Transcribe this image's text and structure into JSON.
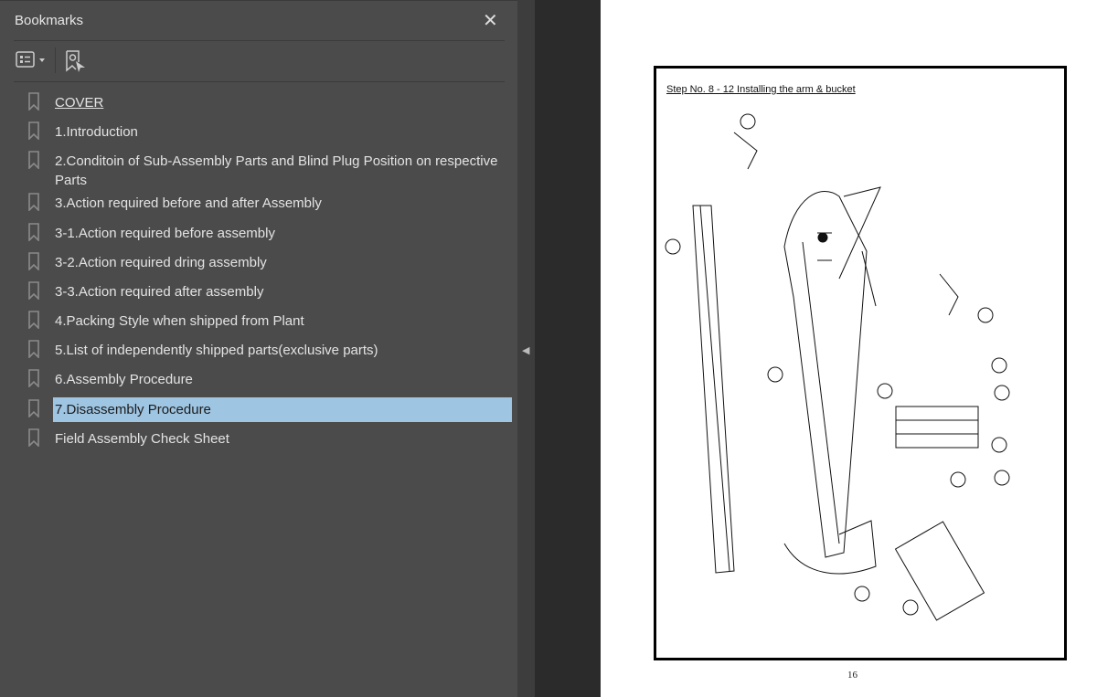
{
  "panel": {
    "title": "Bookmarks",
    "close_icon": "close-icon",
    "options_icon": "list-options-icon",
    "add_bookmark_icon": "add-bookmark-icon"
  },
  "bookmarks": [
    {
      "label": "COVER"
    },
    {
      "label": "1.Introduction"
    },
    {
      "label": "2.Conditoin of Sub-Assembly Parts and Blind Plug Position on respective Parts"
    },
    {
      "label": "3.Action required before and after Assembly"
    },
    {
      "label": "3-1.Action required before assembly"
    },
    {
      "label": "3-2.Action required dring assembly"
    },
    {
      "label": "3-3.Action required after assembly"
    },
    {
      "label": "4.Packing Style when shipped from Plant"
    },
    {
      "label": "5.List of independently shipped parts(exclusive parts)"
    },
    {
      "label": "6.Assembly Procedure"
    },
    {
      "label": "7.Disassembly Procedure",
      "selected": true
    },
    {
      "label": "Field Assembly Check Sheet"
    }
  ],
  "colors": {
    "selected": "#9ec5e2",
    "panel": "#4b4b4b"
  },
  "document": {
    "step_title": "Step No. 8 - 12 Installing the arm & bucket",
    "page_number": "16"
  }
}
